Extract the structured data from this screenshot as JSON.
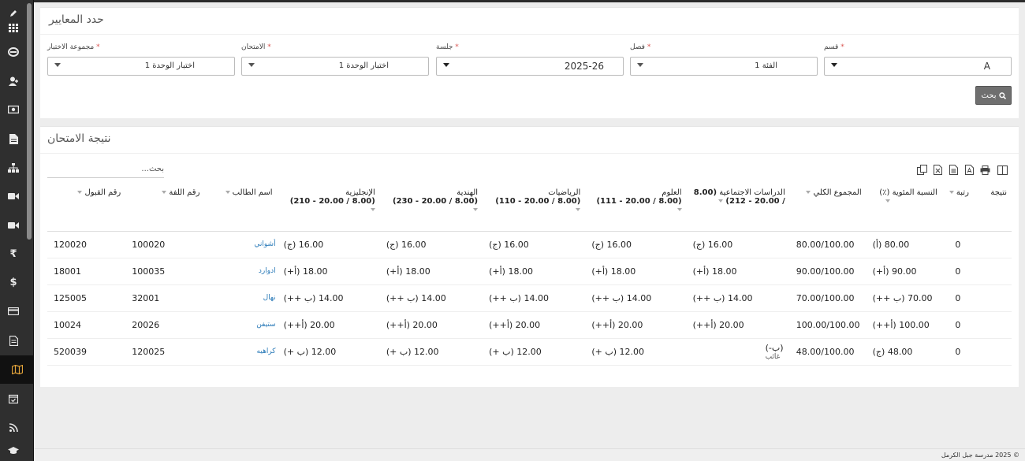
{
  "sidebar": {
    "items": [
      {
        "icon": "pencil-icon"
      },
      {
        "icon": "grid-icon"
      },
      {
        "icon": "book-icon"
      },
      {
        "icon": "user-plus-icon"
      },
      {
        "icon": "money-icon"
      },
      {
        "icon": "document-icon"
      },
      {
        "icon": "sitemap-icon"
      },
      {
        "icon": "video-icon"
      },
      {
        "icon": "video-icon"
      },
      {
        "icon": "rupee-icon",
        "glyph": "₹"
      },
      {
        "icon": "dollar-icon",
        "glyph": "$"
      },
      {
        "icon": "credit-card-icon"
      },
      {
        "icon": "file-text-icon"
      },
      {
        "icon": "map-icon",
        "active": true
      },
      {
        "icon": "calendar-check-icon"
      },
      {
        "icon": "rss-icon"
      },
      {
        "icon": "graduation-cap-icon"
      }
    ]
  },
  "criteria": {
    "title": "حدد المعايير",
    "fields": {
      "class": {
        "label": "فصل",
        "value": "الفئة 1"
      },
      "section": {
        "label": "قسم",
        "value": "A"
      },
      "session": {
        "label": "جلسة",
        "value": "2025-26"
      },
      "exam": {
        "label": "الامتحان",
        "value": "اختبار الوحدة 1"
      },
      "exam_group": {
        "label": "مجموعة الاختبار",
        "value": "اختبار الوحدة 1"
      }
    },
    "required_mark": "*",
    "search_button": "بحث"
  },
  "results": {
    "title": "نتيجة الامتحان",
    "search_placeholder": "بحث...",
    "toolbar": [
      "columns-icon",
      "print-icon",
      "pdf-icon",
      "csv-icon",
      "excel-icon",
      "copy-icon"
    ],
    "columns": {
      "admission_no": "رقم القبول",
      "roll_no": "رقم اللفة",
      "student_name": "اسم الطالب",
      "english": "الإنجليزية",
      "english_sub": "(8.00 / 20.00 - 210)",
      "hindi": "الهندية",
      "hindi_sub": "(8.00 / 20.00 - 230)",
      "math": "الرياضيات",
      "math_sub": "(8.00 / 20.00 - 110)",
      "science": "العلوم",
      "science_sub": "(8.00 / 20.00 - 111)",
      "social": "الدراسات الاجتماعية",
      "social_sub": "(8.00 / 20.00 - 212)",
      "grand_total": "المجموع الكلي",
      "percent": "النسبة المئوية (٪)",
      "rank": "رتبة",
      "result": "نتيجة"
    },
    "rows": [
      {
        "admission_no": "120020",
        "roll_no": "100020",
        "name": "أشواني",
        "english": "16.00 (ج)",
        "hindi": "16.00 (ج)",
        "math": "16.00 (ج)",
        "science": "16.00 (ج)",
        "social": "16.00 (ج)",
        "social_note": "",
        "total": "80.00/100.00",
        "percent": "80.00 (أ)",
        "rank": "0",
        "result": ""
      },
      {
        "admission_no": "18001",
        "roll_no": "100035",
        "name": "ادوارد",
        "english": "18.00 (أ+)",
        "hindi": "18.00 (أ+)",
        "math": "18.00 (أ+)",
        "science": "18.00 (أ+)",
        "social": "18.00 (أ+)",
        "social_note": "",
        "total": "90.00/100.00",
        "percent": "90.00 (أ+)",
        "rank": "0",
        "result": ""
      },
      {
        "admission_no": "125005",
        "roll_no": "32001",
        "name": "نهال",
        "english": "14.00 (ب ++)",
        "hindi": "14.00 (ب ++)",
        "math": "14.00 (ب ++)",
        "science": "14.00 (ب ++)",
        "social": "14.00 (ب ++)",
        "social_note": "",
        "total": "70.00/100.00",
        "percent": "70.00 (ب ++)",
        "rank": "0",
        "result": ""
      },
      {
        "admission_no": "10024",
        "roll_no": "20026",
        "name": "ستيفن",
        "english": "20.00 (أ++)",
        "hindi": "20.00 (أ++)",
        "math": "20.00 (أ++)",
        "science": "20.00 (أ++)",
        "social": "20.00 (أ++)",
        "social_note": "",
        "total": "100.00/100.00",
        "percent": "100.00 (أ++)",
        "rank": "0",
        "result": ""
      },
      {
        "admission_no": "520039",
        "roll_no": "120025",
        "name": "كراهيه",
        "english": "12.00 (ب +)",
        "hindi": "12.00 (ب +)",
        "math": "12.00 (ب +)",
        "science": "12.00 (ب +)",
        "social": "(ب-)",
        "social_note": "غائب",
        "total": "48.00/100.00",
        "percent": "48.00 (ج)",
        "rank": "0",
        "result": ""
      }
    ]
  },
  "footer": {
    "text": "© 2025 مدرسة جبل الكرمل"
  },
  "colors": {
    "sidebar": "#2f2f2f",
    "link": "#2a7ab8",
    "required": "#d9534f",
    "active_icon": "#e2a33a"
  }
}
